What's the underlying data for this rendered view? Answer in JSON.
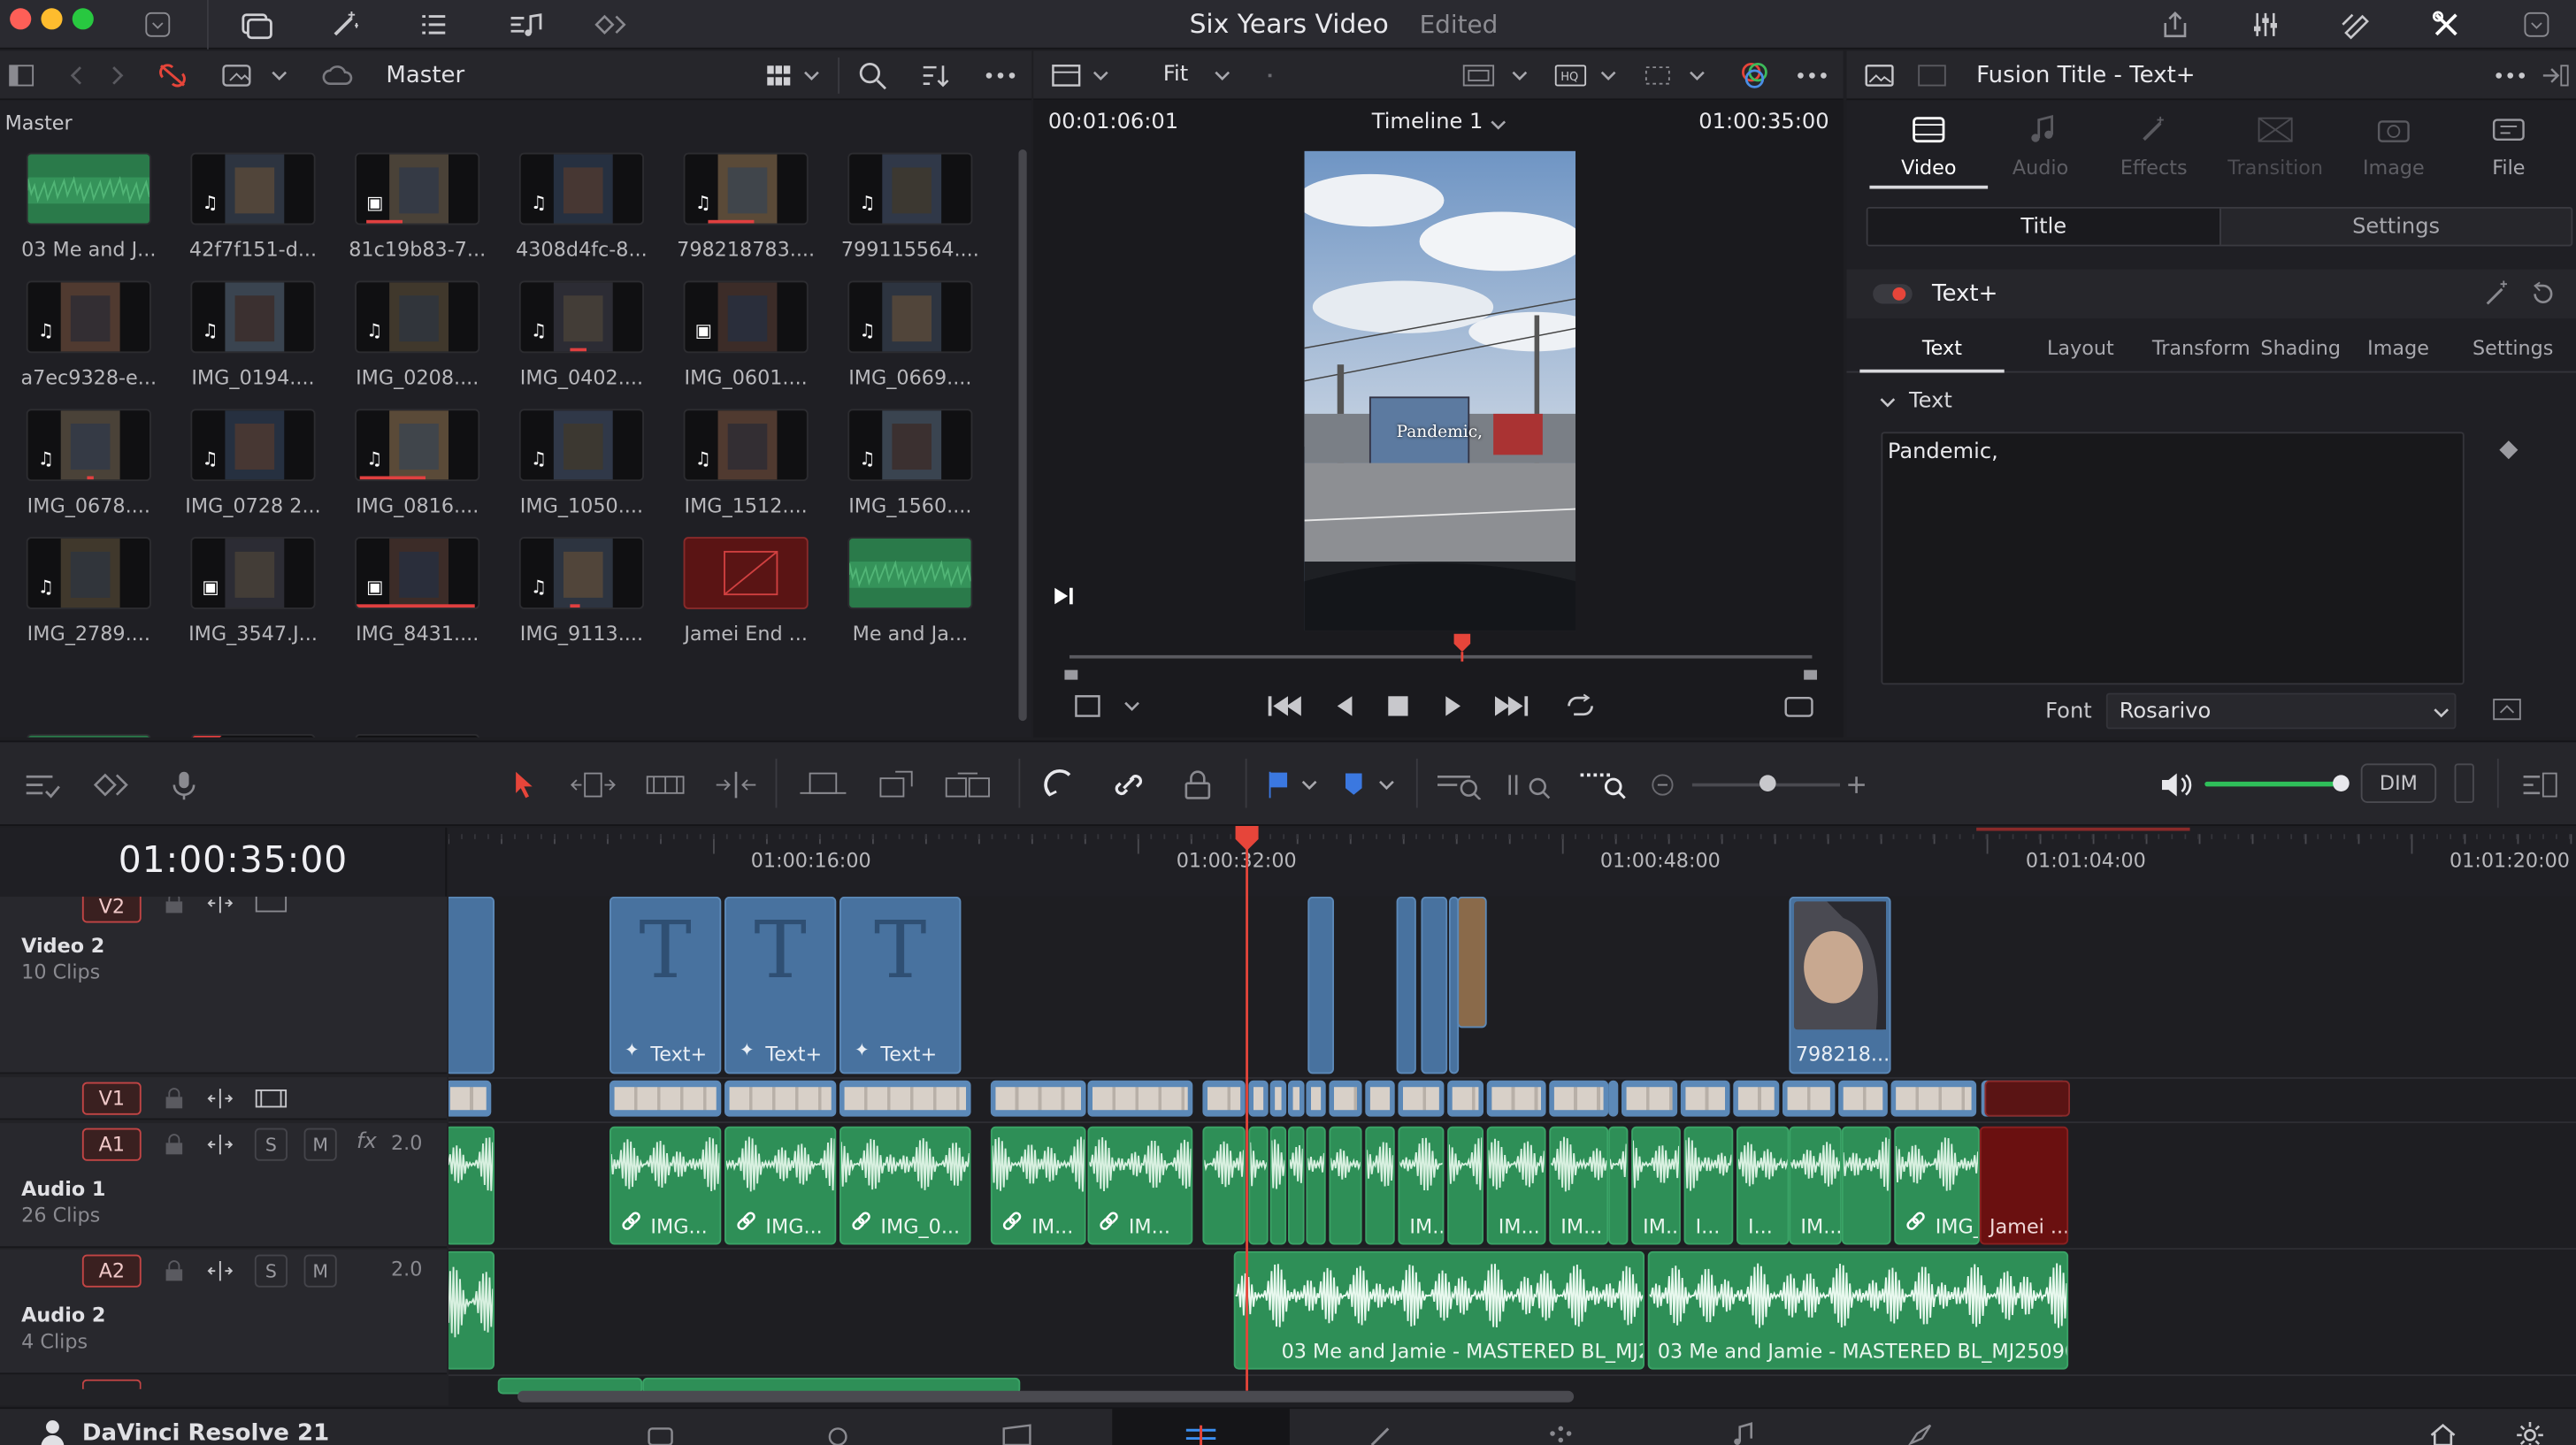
{
  "titlebar": {
    "project_title": "Six Years Video",
    "status": "Edited"
  },
  "media_pool": {
    "bin_name": "Master",
    "breadcrumb": "Master",
    "items": [
      {
        "label": "03 Me and J...",
        "kind": "audio"
      },
      {
        "label": "42f7f151-d...",
        "kind": "video"
      },
      {
        "label": "81c19b83-7...",
        "kind": "image"
      },
      {
        "label": "4308d4fc-8...",
        "kind": "video"
      },
      {
        "label": "798218783....",
        "kind": "video"
      },
      {
        "label": "799115564....",
        "kind": "video"
      },
      {
        "label": "a7ec9328-e...",
        "kind": "video"
      },
      {
        "label": "IMG_0194....",
        "kind": "video"
      },
      {
        "label": "IMG_0208....",
        "kind": "video"
      },
      {
        "label": "IMG_0402....",
        "kind": "video"
      },
      {
        "label": "IMG_0601....",
        "kind": "image"
      },
      {
        "label": "IMG_0669....",
        "kind": "video"
      },
      {
        "label": "IMG_0678....",
        "kind": "video"
      },
      {
        "label": "IMG_0728 2...",
        "kind": "video"
      },
      {
        "label": "IMG_0816....",
        "kind": "video"
      },
      {
        "label": "IMG_1050....",
        "kind": "video"
      },
      {
        "label": "IMG_1512....",
        "kind": "video"
      },
      {
        "label": "IMG_1560....",
        "kind": "video"
      },
      {
        "label": "IMG_2789....",
        "kind": "video"
      },
      {
        "label": "IMG_3547.J...",
        "kind": "image"
      },
      {
        "label": "IMG_8431....",
        "kind": "image"
      },
      {
        "label": "IMG_9113....",
        "kind": "video"
      },
      {
        "label": "Jamei End ...",
        "kind": "title"
      },
      {
        "label": "Me and Ja...",
        "kind": "audio"
      }
    ]
  },
  "viewer": {
    "zoom": "Fit",
    "source_timecode": "00:01:06:01",
    "timeline_name": "Timeline 1",
    "record_timecode": "01:00:35:00",
    "overlay_caption": "Pandemic,"
  },
  "inspector": {
    "title": "Fusion Title - Text+",
    "tabs": [
      "Video",
      "Audio",
      "Effects",
      "Transition",
      "Image",
      "File"
    ],
    "subtabs": [
      "Title",
      "Settings"
    ],
    "section": "Text+",
    "text_tabs": [
      "Text",
      "Layout",
      "Transform",
      "Shading",
      "Image",
      "Settings"
    ],
    "text_group": "Text",
    "text_value": "Pandemic,",
    "font_label": "Font",
    "font_value": "Rosarivo"
  },
  "timeline": {
    "timecode": "01:00:35:00",
    "ruler": [
      "01:00:16:00",
      "01:00:32:00",
      "01:00:48:00",
      "01:01:04:00",
      "01:01:20:00"
    ],
    "monitor_button": "DIM",
    "tracks": {
      "v2": {
        "badge": "V2",
        "name": "Video 2",
        "count": "10 Clips"
      },
      "v1": {
        "badge": "V1"
      },
      "a1": {
        "badge": "A1",
        "name": "Audio 1",
        "count": "26 Clips",
        "level": "2.0",
        "fx": "fx"
      },
      "a2": {
        "badge": "A2",
        "name": "Audio 2",
        "count": "4 Clips",
        "level": "2.0"
      }
    },
    "solo_label": "S",
    "mute_label": "M",
    "title_clip_label": "Text+",
    "v2_image_clip": "798218...",
    "a1_labels": [
      "IMG...",
      "IMG...",
      "IMG_0...",
      "IM...",
      "IM...",
      "IM...",
      "IM...",
      "IM...",
      "IM...",
      "I...",
      "I...",
      "IM...",
      "IMG_0...",
      "Jamei ..."
    ],
    "a2_labels": [
      "03 Me and Jamie - MASTERED BL_MJ2...",
      "03 Me and Jamie - MASTERED BL_MJ250905..."
    ]
  },
  "footer": {
    "app_name": "DaVinci Resolve 21"
  },
  "colors": {
    "accent_red": "#e6453a",
    "video_clip": "#48729f",
    "audio_clip": "#2e8f57",
    "panel_bg": "#1f1f24"
  }
}
